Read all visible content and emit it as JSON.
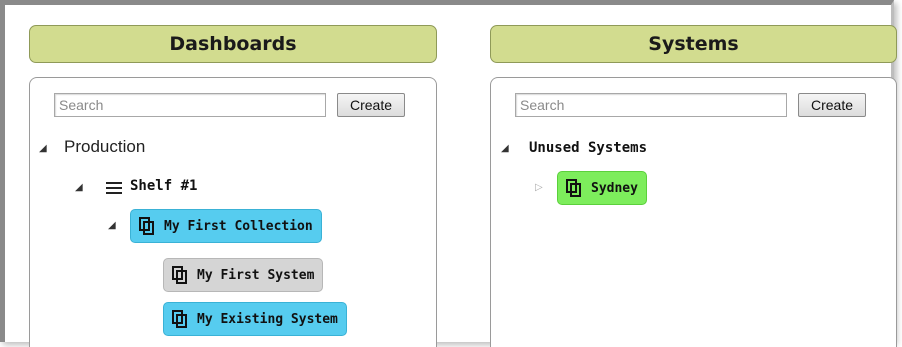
{
  "dashboards": {
    "title": "Dashboards",
    "search_placeholder": "Search",
    "create_label": "Create",
    "tree": {
      "root_label": "Production",
      "shelf_label": "Shelf #1",
      "collection_label": "My First Collection",
      "systems": [
        "My First System",
        "My Existing System"
      ]
    }
  },
  "systems": {
    "title": "Systems",
    "search_placeholder": "Search",
    "create_label": "Create",
    "tree": {
      "group_label": "Unused Systems",
      "item_label": "Sydney"
    }
  },
  "colors": {
    "header_bg": "#d2dc8f",
    "collection_chip": "#56ccef",
    "system_chip_inactive": "#d5d5d5",
    "system_chip_active": "#56ccef",
    "unused_chip": "#7ded5c"
  },
  "icons": {
    "collapse": "triangle-down-icon",
    "expand": "triangle-right-icon",
    "shelf": "hamburger-icon",
    "item": "copy-icon"
  }
}
